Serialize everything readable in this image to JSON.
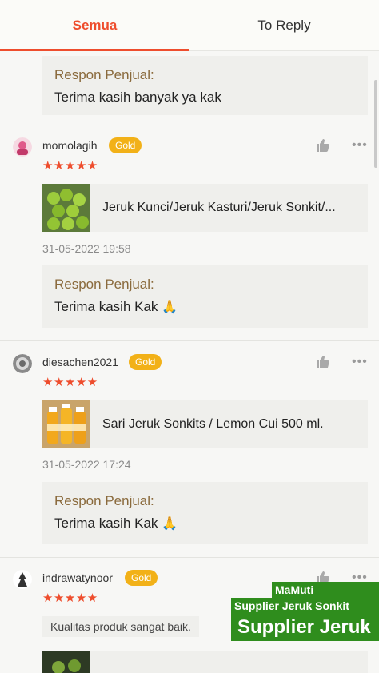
{
  "tabs": {
    "all": "Semua",
    "to_reply": "To Reply"
  },
  "seller_reply_label": "Respon Penjual:",
  "top_reply": {
    "text": "Terima kasih banyak ya kak"
  },
  "reviews": [
    {
      "username": "momolagih",
      "badge": "Gold",
      "stars": "★★★★★",
      "product": "Jeruk Kunci/Jeruk Kasturi/Jeruk Sonkit/...",
      "date": "31-05-2022 19:58",
      "reply": "Terima kasih Kak",
      "reply_emoji": "🙏"
    },
    {
      "username": "diesachen2021",
      "badge": "Gold",
      "stars": "★★★★★",
      "product": "Sari Jeruk Sonkits / Lemon Cui 500 ml.",
      "date": "31-05-2022 17:24",
      "reply": "Terima kasih Kak",
      "reply_emoji": "🙏"
    },
    {
      "username": "indrawatynoor",
      "badge": "Gold",
      "stars": "★★★★★",
      "comment": "Kualitas produk sangat baik."
    }
  ],
  "watermark": {
    "line1": "MaMuti",
    "line2": "Supplier Jeruk Sonkit",
    "line3": "Supplier Jeruk"
  },
  "colors": {
    "accent": "#ee4d2d",
    "badge": "#f2b118",
    "watermark": "#2f8d1d"
  },
  "icons": [
    "thumbs-up-icon",
    "more-icon",
    "star-icon"
  ]
}
